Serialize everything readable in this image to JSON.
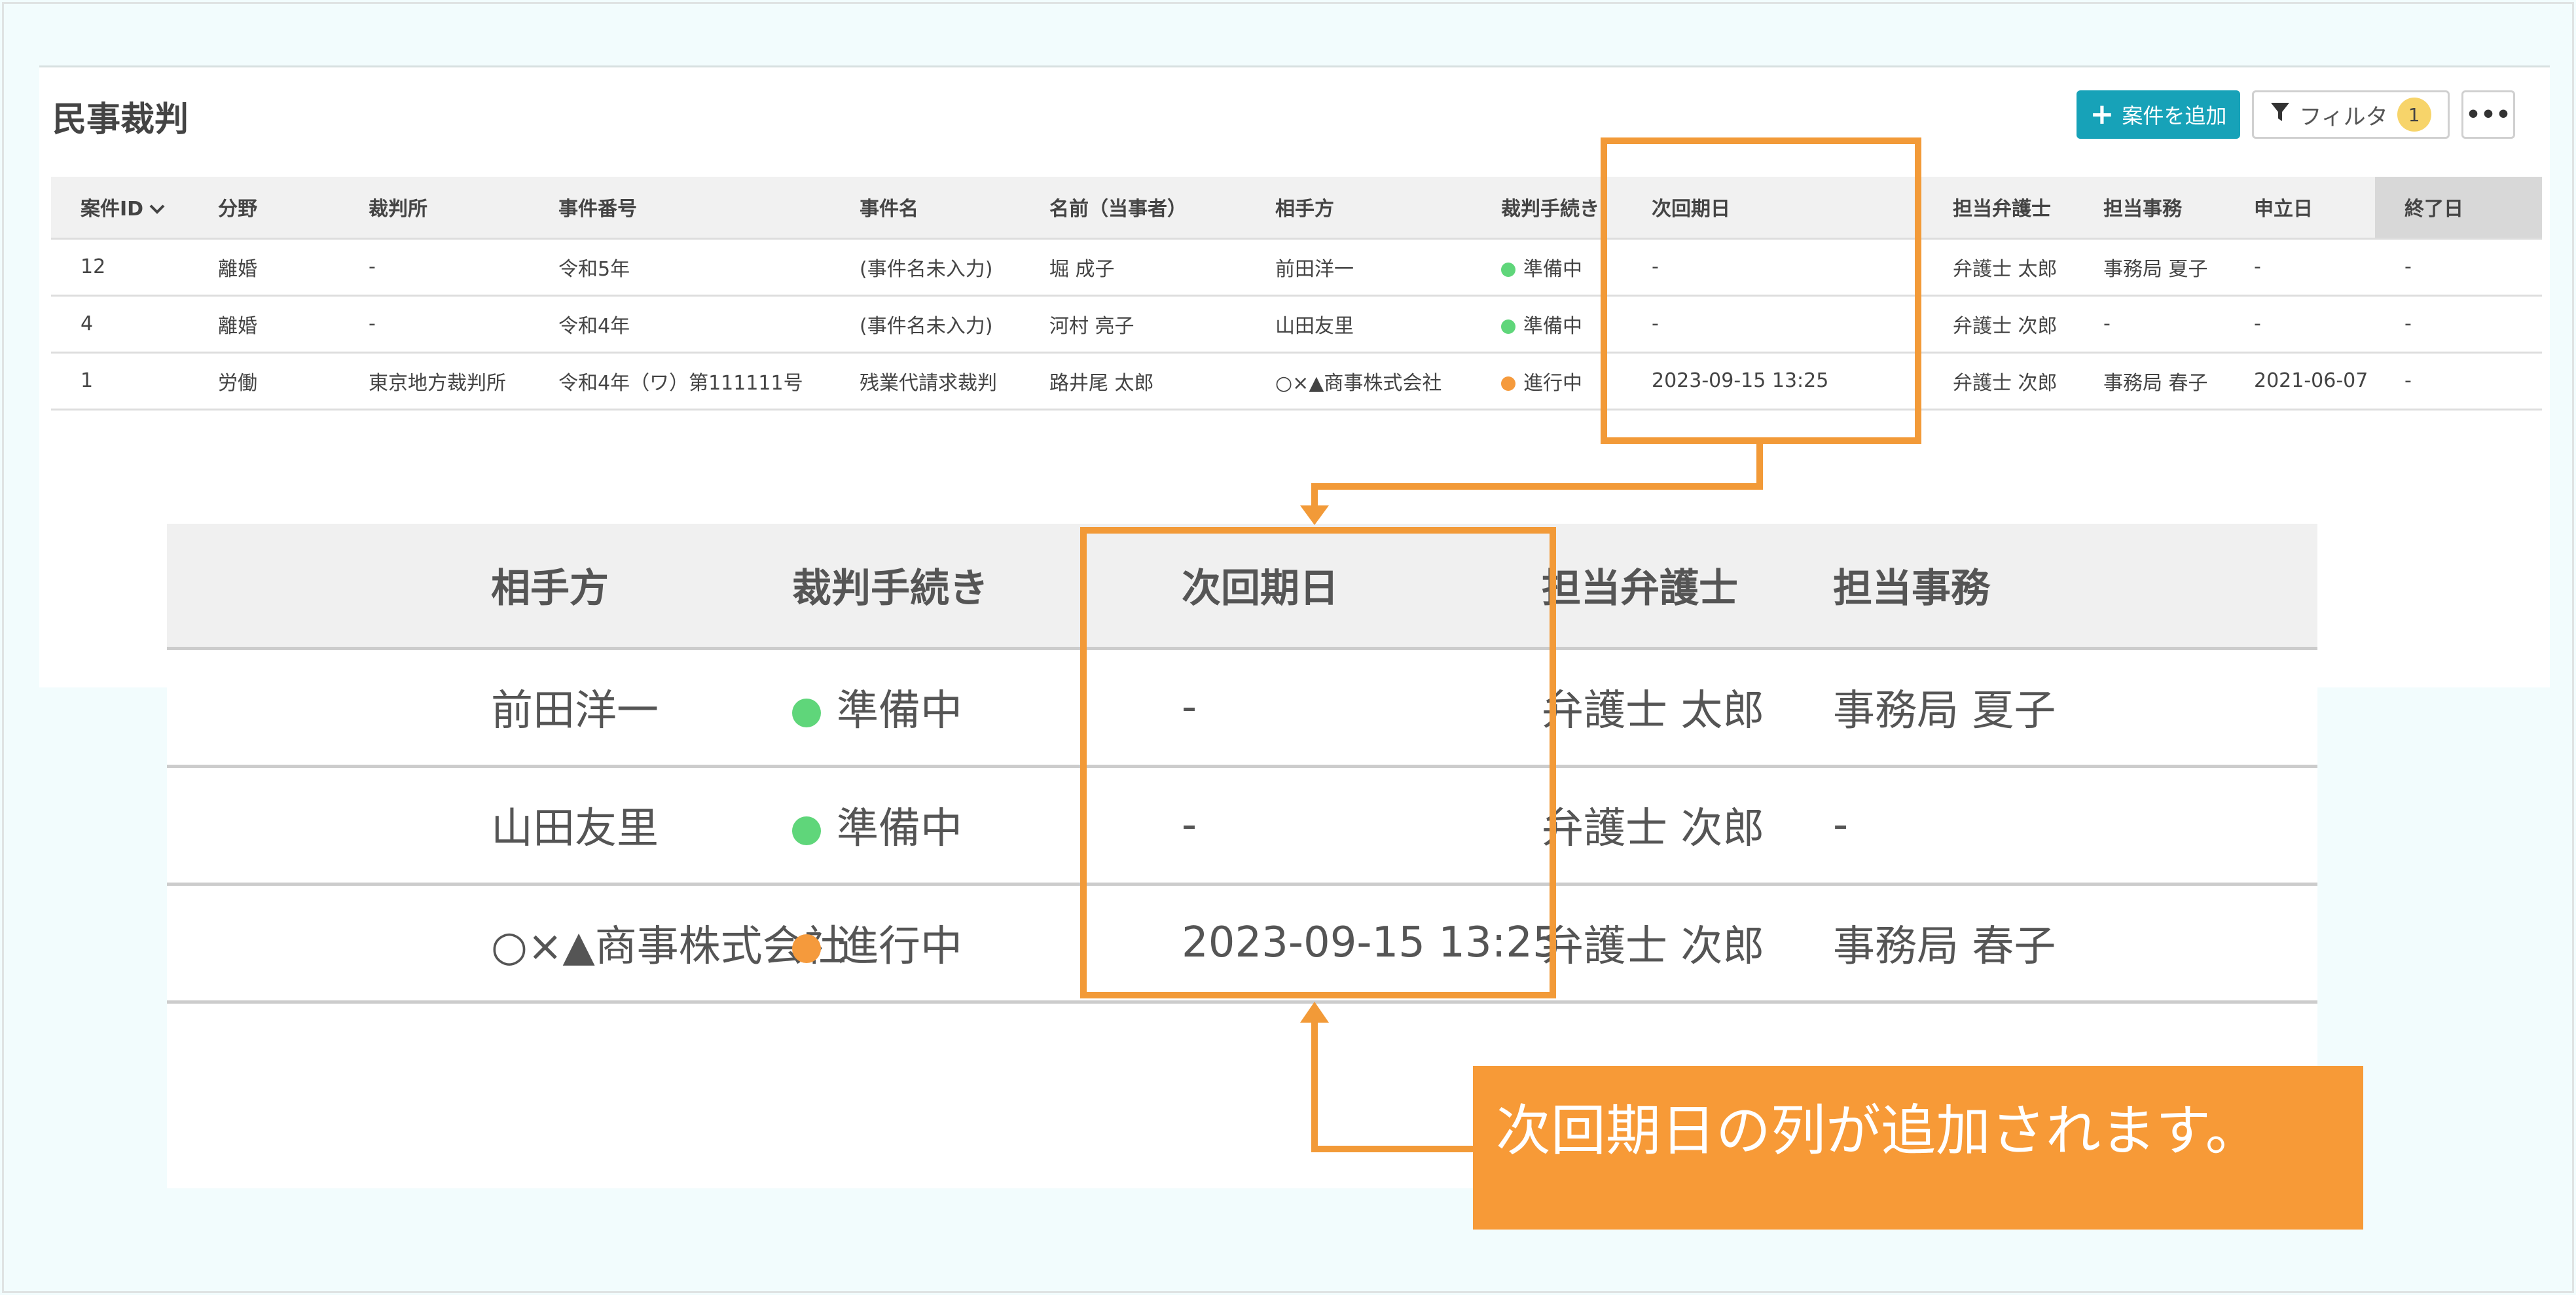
{
  "page": {
    "title": "民事裁判"
  },
  "toolbar": {
    "add_label": "案件を追加",
    "filter_label": "フィルタ",
    "filter_count": "1",
    "more_label": "•••"
  },
  "table": {
    "headers": [
      "案件ID",
      "分野",
      "裁判所",
      "事件番号",
      "事件名",
      "名前（当事者）",
      "相手方",
      "裁判手続き",
      "次回期日",
      "担当弁護士",
      "担当事務",
      "申立日",
      "終了日"
    ],
    "rows": [
      [
        "12",
        "離婚",
        "-",
        "令和5年",
        "(事件名未入力)",
        "堀 成子",
        "前田洋一",
        "準備中",
        "-",
        "弁護士 太郎",
        "事務局 夏子",
        "-",
        "-"
      ],
      [
        "4",
        "離婚",
        "-",
        "令和4年",
        "(事件名未入力)",
        "河村 亮子",
        "山田友里",
        "準備中",
        "-",
        "弁護士 次郎",
        "-",
        "-",
        "-"
      ],
      [
        "1",
        "労働",
        "東京地方裁判所",
        "令和4年（ワ）第111111号",
        "残業代請求裁判",
        "路井尾 太郎",
        "○×▲商事株式会社",
        "進行中",
        "2023-09-15 13:25",
        "弁護士 次郎",
        "事務局 春子",
        "2021-06-07",
        "-"
      ]
    ],
    "status_colors": {
      "準備中": "#5fd67a",
      "進行中": "#f59a3c"
    }
  },
  "zoom": {
    "headers": [
      "相手方",
      "裁判手続き",
      "次回期日",
      "担当弁護士",
      "担当事務"
    ],
    "rows": [
      [
        "前田洋一",
        "準備中",
        "-",
        "弁護士 太郎",
        "事務局 夏子"
      ],
      [
        "山田友里",
        "準備中",
        "-",
        "弁護士 次郎",
        "-"
      ],
      [
        "○×▲商事株式会社",
        "進行中",
        "2023-09-15 13:25",
        "弁護士 次郎",
        "事務局 春子"
      ]
    ]
  },
  "callout": {
    "text": "次回期日の列が追加されます。"
  },
  "colors": {
    "accent": "#17a2b8",
    "highlight": "#f29a38",
    "link": "#1a7fa1"
  }
}
